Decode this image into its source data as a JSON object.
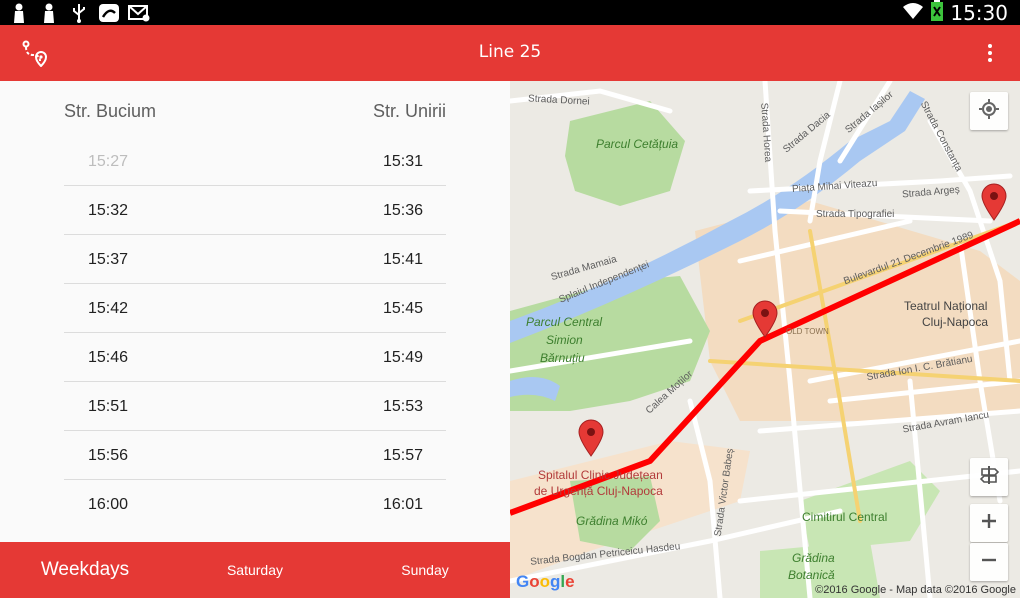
{
  "status_bar": {
    "time": "15:30",
    "left_icons": [
      "notification-figure-icon",
      "notification-figure-icon",
      "usb-icon",
      "app-notification-icon",
      "email-icon"
    ],
    "right_icons": [
      "wifi-icon",
      "battery-icon"
    ]
  },
  "app_bar": {
    "title": "Line 25",
    "logo_icon": "route-pin-icon",
    "menu_icon": "more-vert-icon"
  },
  "schedule": {
    "from_stop": "Str. Bucium",
    "to_stop": "Str. Unirii",
    "rows": [
      {
        "departure": "15:27",
        "arrival": "15:31",
        "past": true
      },
      {
        "departure": "15:32",
        "arrival": "15:36",
        "past": false
      },
      {
        "departure": "15:37",
        "arrival": "15:41",
        "past": false
      },
      {
        "departure": "15:42",
        "arrival": "15:45",
        "past": false
      },
      {
        "departure": "15:46",
        "arrival": "15:49",
        "past": false
      },
      {
        "departure": "15:51",
        "arrival": "15:53",
        "past": false
      },
      {
        "departure": "15:56",
        "arrival": "15:57",
        "past": false
      },
      {
        "departure": "16:00",
        "arrival": "16:01",
        "past": false
      }
    ]
  },
  "day_tabs": {
    "weekdays": "Weekdays",
    "saturday": "Saturday",
    "sunday": "Sunday",
    "selected": "weekdays"
  },
  "map": {
    "labels": {
      "strada_dornei": "Strada Dornei",
      "parcul_cetatuia": "Parcul Cetățuia",
      "strada_horea": "Strada Horea",
      "strada_dacia": "Strada Dacia",
      "strada_iasilor": "Strada Iașilor",
      "strada_constanta": "Strada Constanța",
      "piata_mihai_viteazu": "Piața Mihai Viteazu",
      "strada_arges": "Strada Argeș",
      "strada_tipografiei": "Strada Tipografiei",
      "strada_mamaia": "Strada Mamaia",
      "splaiul_independentei": "Splaiul Independenței",
      "bulevardul_21_decembrie": "Bulevardul 21 Decembrie 1989",
      "teatrul_1": "Teatrul Național",
      "teatrul_2": "Cluj-Napoca",
      "parcul_central_1": "Parcul Central",
      "parcul_central_2": "Simion",
      "parcul_central_3": "Bărnuțiu",
      "old_town": "OLD TOWN",
      "calea_motilor": "Calea Moților",
      "strada_ion_bratianu": "Strada Ion I. C. Brătianu",
      "strada_avram_iancu": "Strada Avram Iancu",
      "spital_1": "Spitalul Clinic Județean",
      "spital_2": "de Urgență Cluj-Napoca",
      "strada_victor_babes": "Strada Victor Babeș",
      "gradina_miko": "Grădina Mikó",
      "cimitirul_central": "Cimitirul Central",
      "strada_bogdan": "Strada Bogdan Petriceicu Hasdeu",
      "gradina_1": "Grădina",
      "gradina_2": "Botanică"
    },
    "google_logo": "Google",
    "attribution": "©2016 Google - Map data ©2016 Google",
    "route_color": "#ff0000",
    "marker_color": "#e53935"
  },
  "colors": {
    "accent": "#e53935",
    "status_bar": "#000000",
    "past_time": "#bdbdbd"
  }
}
